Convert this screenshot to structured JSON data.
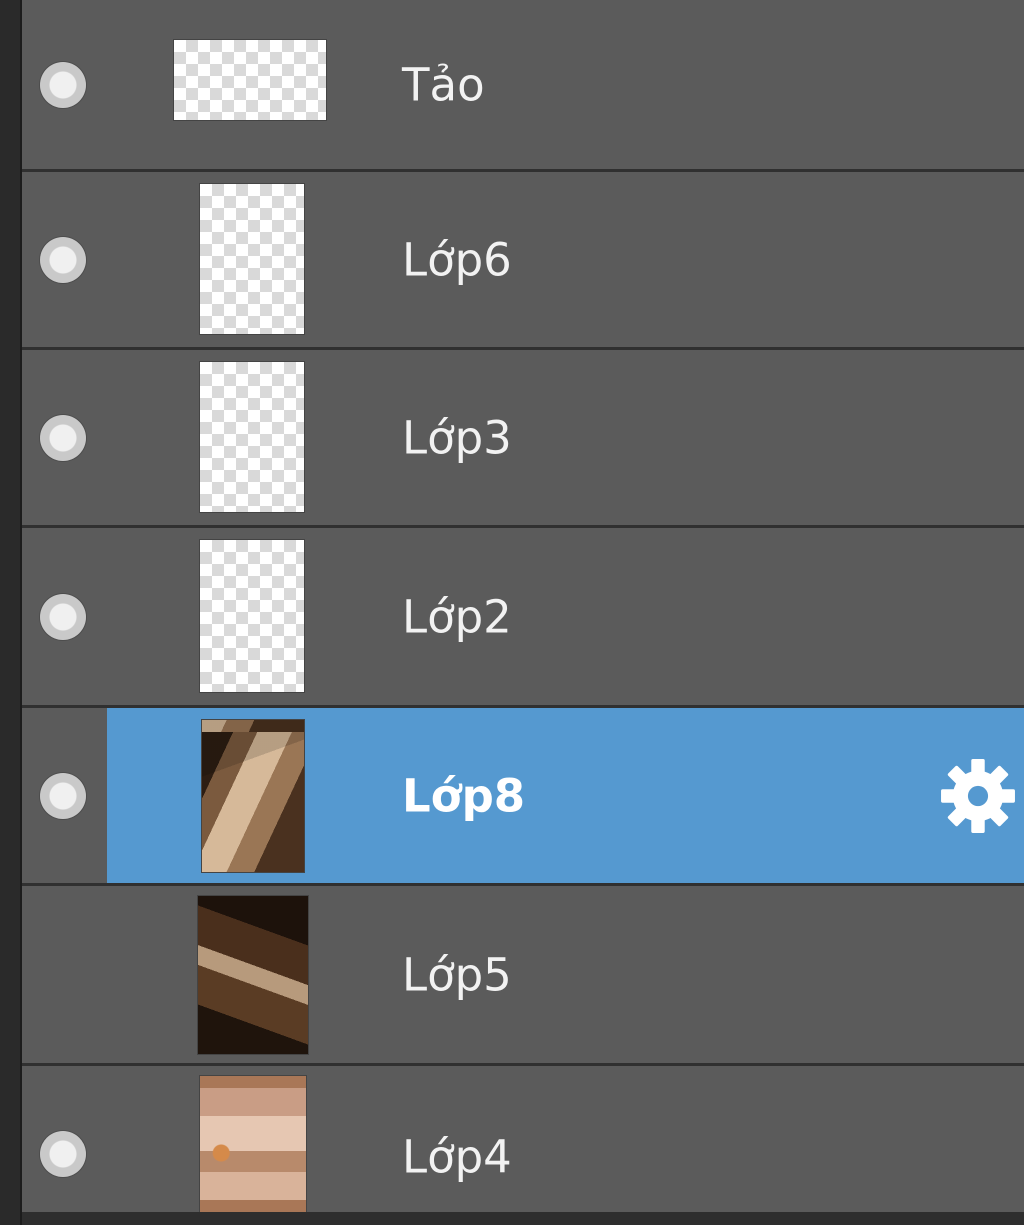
{
  "layers_panel": {
    "layers": [
      {
        "name": "Tảo",
        "visible_toggle": true,
        "thumbnail": "transparent-wide"
      },
      {
        "name": "Lớp6",
        "visible_toggle": true,
        "thumbnail": "transparent"
      },
      {
        "name": "Lớp3",
        "visible_toggle": true,
        "thumbnail": "transparent"
      },
      {
        "name": "Lớp2",
        "visible_toggle": true,
        "thumbnail": "transparent"
      },
      {
        "name": "Lớp8",
        "visible_toggle": true,
        "thumbnail": "photo",
        "selected": true,
        "settings_icon": "gear-icon"
      },
      {
        "name": "Lớp5",
        "visible_toggle": false,
        "thumbnail": "photo"
      },
      {
        "name": "Lớp4",
        "visible_toggle": true,
        "thumbnail": "photo"
      }
    ],
    "colors": {
      "row_background": "#5b5b5b",
      "selected_background": "#5599d0",
      "text": "#f2f2f2"
    }
  }
}
